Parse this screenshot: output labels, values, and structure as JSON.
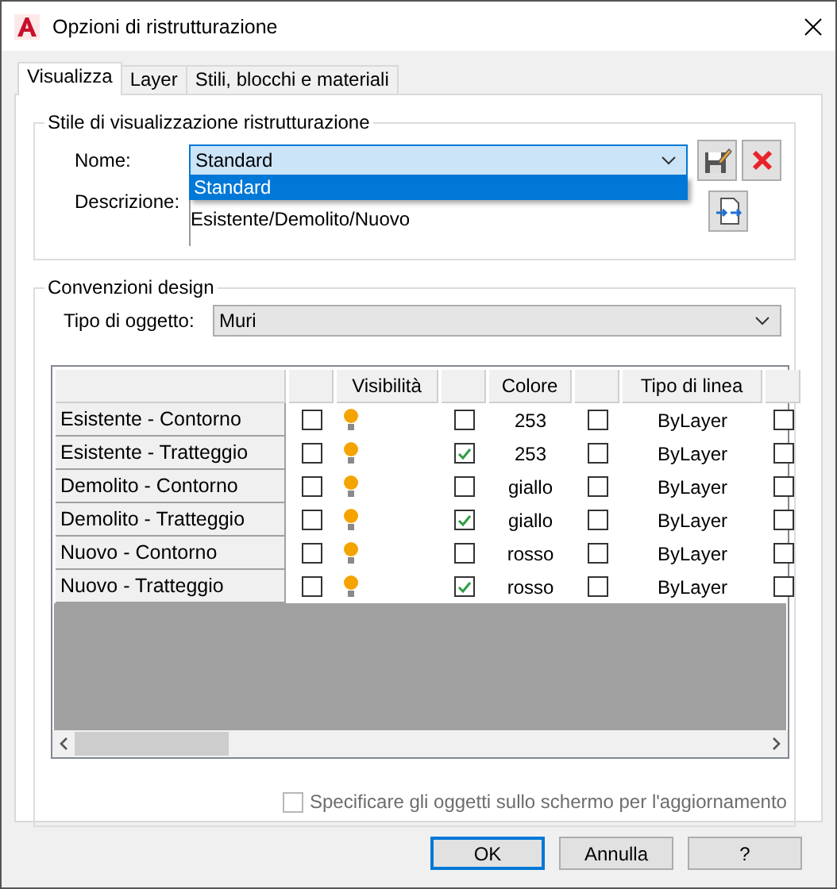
{
  "window": {
    "title": "Opzioni di ristrutturazione"
  },
  "tabs": [
    {
      "label": "Visualizza",
      "selected": true
    },
    {
      "label": "Layer",
      "selected": false
    },
    {
      "label": "Stili, blocchi e materiali",
      "selected": false
    }
  ],
  "display_style": {
    "title": "Stile di visualizzazione ristrutturazione",
    "name_label": "Nome:",
    "name_value": "Standard",
    "name_options": [
      {
        "label": "Standard",
        "selected": true
      }
    ],
    "description_label": "Descrizione:",
    "description": "Esistente/Demolito/Nuovo"
  },
  "design_conventions": {
    "title": "Convenzioni design",
    "object_type_label": "Tipo di oggetto:",
    "object_type": "Muri",
    "table": {
      "columns": {
        "visibility": "Visibilità",
        "colore": "Colore",
        "linetype": "Tipo di linea"
      },
      "rows": [
        {
          "name": "Esistente - Contorno",
          "column_1_checked": false,
          "visible": true,
          "column_3_checked": false,
          "colore": "253",
          "column_5_checked": false,
          "linetype": "ByLayer",
          "column_7_checked": false
        },
        {
          "name": "Esistente - Tratteggio",
          "column_1_checked": false,
          "visible": true,
          "column_3_checked": true,
          "colore": "253",
          "column_5_checked": false,
          "linetype": "ByLayer",
          "column_7_checked": false
        },
        {
          "name": "Demolito - Contorno",
          "column_1_checked": false,
          "visible": true,
          "column_3_checked": false,
          "colore": "giallo",
          "column_5_checked": false,
          "linetype": "ByLayer",
          "column_7_checked": false
        },
        {
          "name": "Demolito - Tratteggio",
          "column_1_checked": false,
          "visible": true,
          "column_3_checked": true,
          "colore": "giallo",
          "column_5_checked": false,
          "linetype": "ByLayer",
          "column_7_checked": false
        },
        {
          "name": "Nuovo - Contorno",
          "column_1_checked": false,
          "visible": true,
          "column_3_checked": false,
          "colore": "rosso",
          "column_5_checked": false,
          "linetype": "ByLayer",
          "column_7_checked": false
        },
        {
          "name": "Nuovo - Tratteggio",
          "column_1_checked": false,
          "visible": true,
          "column_3_checked": true,
          "colore": "rosso",
          "column_5_checked": false,
          "linetype": "ByLayer",
          "column_7_checked": false
        }
      ]
    },
    "select_on_screen": {
      "label": "Specificare gli oggetti sullo schermo per l'aggiornamento",
      "checked": false,
      "disabled": true
    }
  },
  "buttons": [
    {
      "label": "OK",
      "default": true
    },
    {
      "label": "Annulla",
      "default": false
    },
    {
      "label": "?",
      "default": false
    }
  ]
}
